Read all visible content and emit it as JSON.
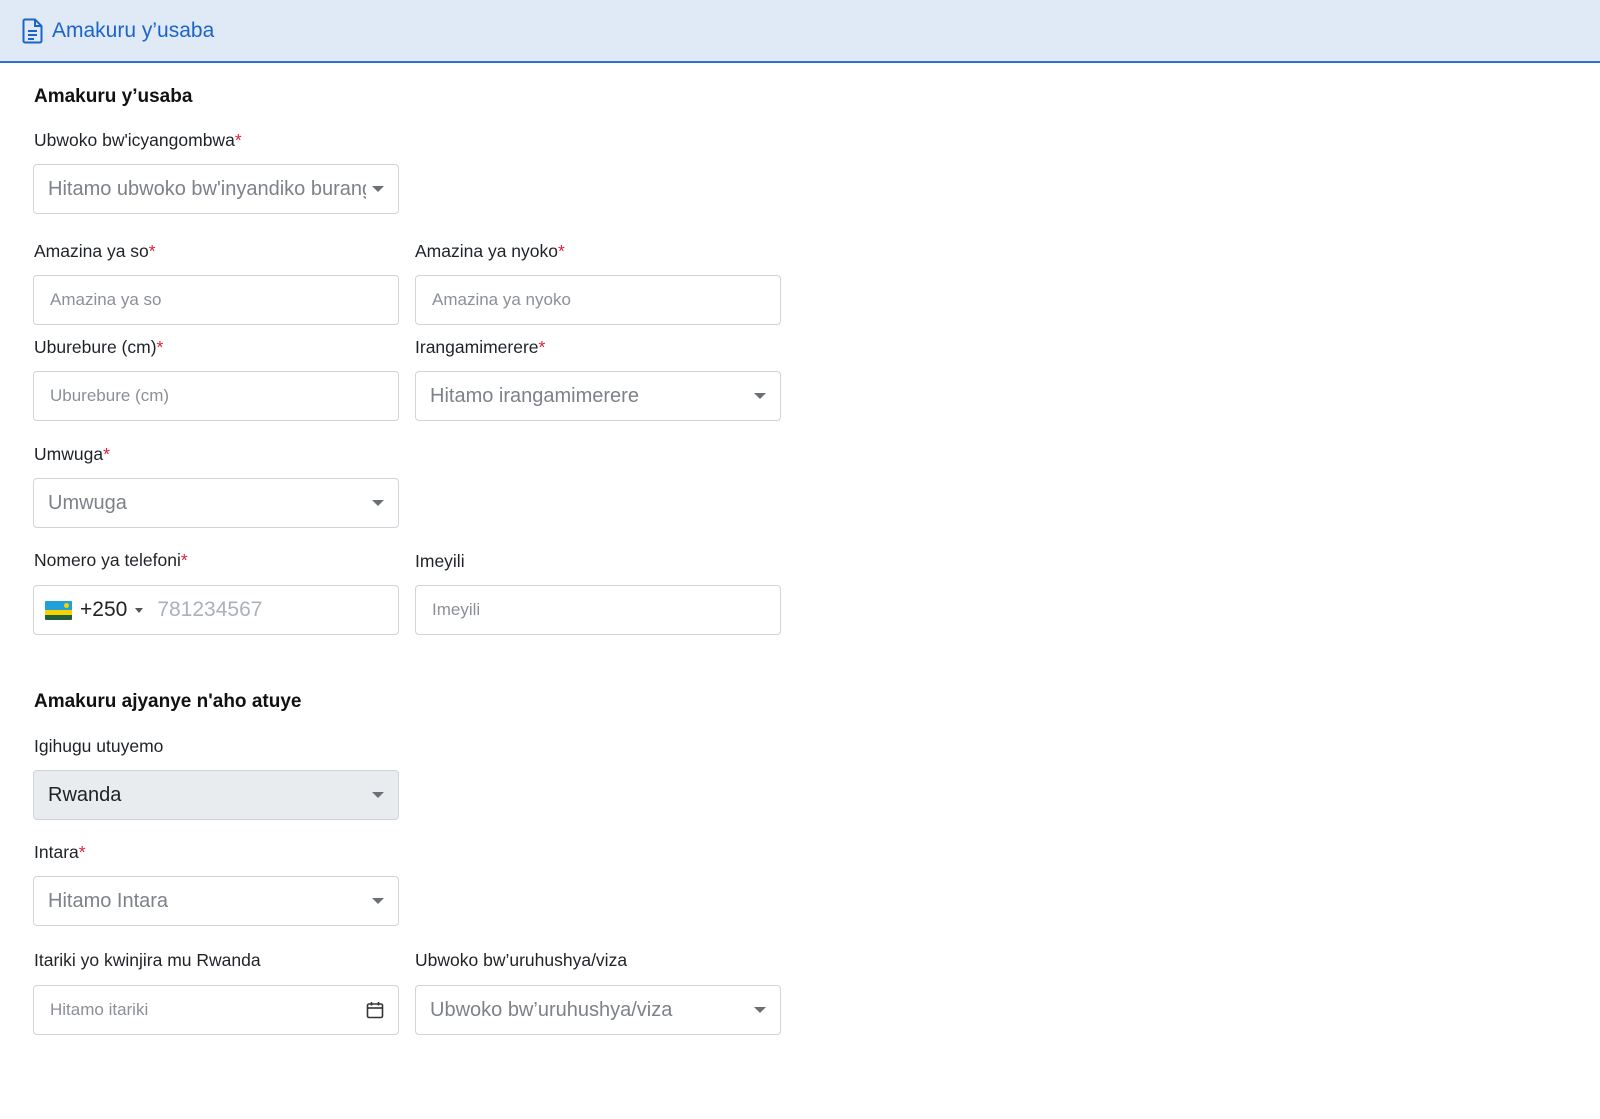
{
  "header": {
    "title": "Amakuru y’usaba",
    "icon": "document-icon"
  },
  "section1": {
    "title": "Amakuru y’usaba",
    "document_type": {
      "label": "Ubwoko bw'icyangombwa",
      "required_mark": "*",
      "placeholder": "Hitamo ubwoko bw'inyandiko buranga"
    },
    "father_name": {
      "label": "Amazina ya so",
      "required_mark": "*",
      "placeholder": "Amazina ya so"
    },
    "mother_name": {
      "label": "Amazina ya nyoko",
      "required_mark": "*",
      "placeholder": "Amazina ya nyoko"
    },
    "height": {
      "label": "Uburebure (cm)",
      "required_mark": "*",
      "placeholder": "Uburebure (cm)"
    },
    "marital_status": {
      "label": "Irangamimerere",
      "required_mark": "*",
      "placeholder": "Hitamo irangamimerere"
    },
    "occupation": {
      "label": "Umwuga",
      "required_mark": "*",
      "placeholder": "Umwuga"
    },
    "phone": {
      "label": "Nomero ya telefoni",
      "required_mark": "*",
      "country_code": "+250",
      "placeholder": "781234567",
      "flag": "rwanda-flag-icon"
    },
    "email": {
      "label": "Imeyili",
      "placeholder": "Imeyili"
    }
  },
  "section2": {
    "title": "Amakuru ajyanye n'aho atuye",
    "country": {
      "label": "Igihugu utuyemo",
      "value": "Rwanda"
    },
    "province": {
      "label": "Intara",
      "required_mark": "*",
      "placeholder": "Hitamo Intara"
    },
    "entry_date": {
      "label": "Itariki yo kwinjira mu Rwanda",
      "placeholder": "Hitamo itariki"
    },
    "visa_type": {
      "label": "Ubwoko bw’uruhushya/viza",
      "placeholder": "Ubwoko bw’uruhushya/viza"
    }
  },
  "colors": {
    "accent": "#1d64c9",
    "header_bg": "#dfeaf6",
    "required": "#e0203a",
    "border": "#cfd4da",
    "disabled_bg": "#e9ecef"
  }
}
